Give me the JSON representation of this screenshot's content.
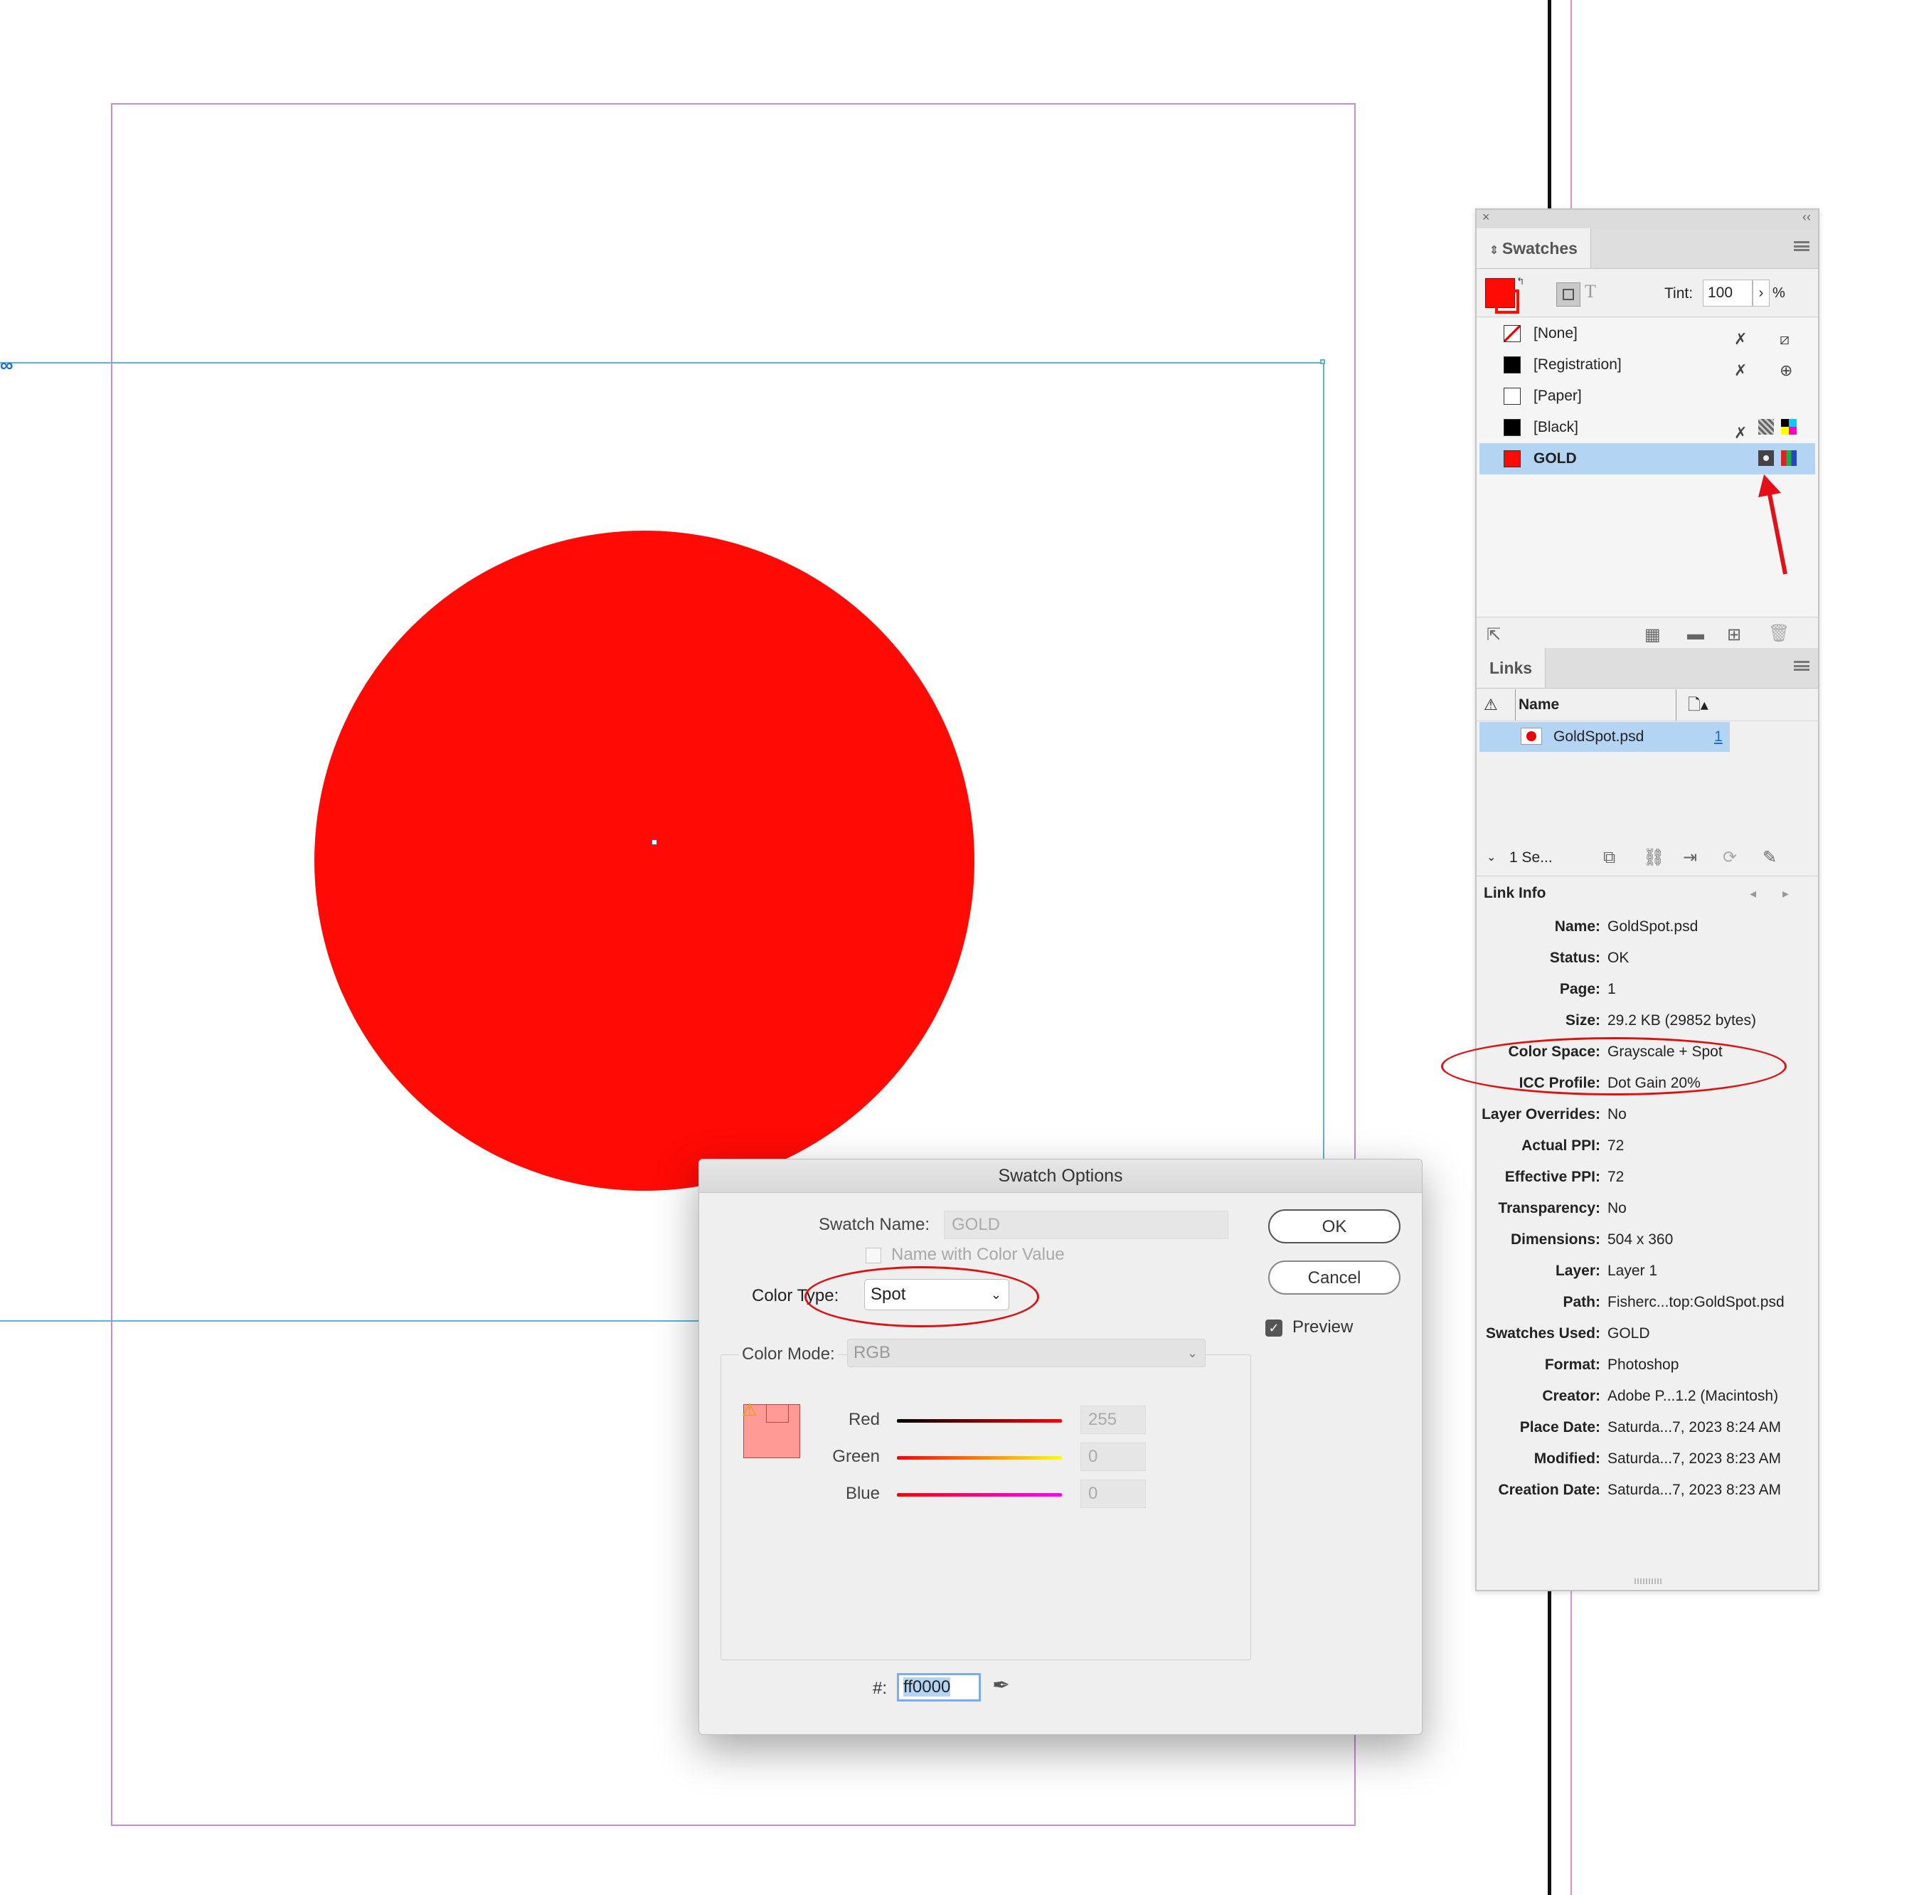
{
  "swatches_panel": {
    "tab_label": "Swatches",
    "tint_label": "Tint:",
    "tint_value": "100",
    "tint_unit": "%",
    "items": [
      {
        "name": "[None]",
        "chip_color": "#ffffff",
        "selected": false
      },
      {
        "name": "[Registration]",
        "chip_color": "#000000",
        "selected": false
      },
      {
        "name": "[Paper]",
        "chip_color": "#ffffff",
        "selected": false
      },
      {
        "name": "[Black]",
        "chip_color": "#000000",
        "selected": false
      },
      {
        "name": "GOLD",
        "chip_color": "#ff0a05",
        "selected": true
      }
    ]
  },
  "links_panel": {
    "tab_label": "Links",
    "column_name": "Name",
    "link_name": "GoldSpot.psd",
    "link_page": "1",
    "selection_summary": "1 Se..."
  },
  "link_info": {
    "title": "Link Info",
    "rows": [
      {
        "label": "Name:",
        "value": "GoldSpot.psd"
      },
      {
        "label": "Status:",
        "value": "OK"
      },
      {
        "label": "Page:",
        "value": "1"
      },
      {
        "label": "Size:",
        "value": "29.2 KB (29852 bytes)"
      },
      {
        "label": "Color Space:",
        "value": "Grayscale + Spot"
      },
      {
        "label": "ICC Profile:",
        "value": "Dot Gain 20%"
      },
      {
        "label": "Layer Overrides:",
        "value": "No"
      },
      {
        "label": "Actual PPI:",
        "value": "72"
      },
      {
        "label": "Effective PPI:",
        "value": "72"
      },
      {
        "label": "Transparency:",
        "value": "No"
      },
      {
        "label": "Dimensions:",
        "value": "504 x 360"
      },
      {
        "label": "Layer:",
        "value": "Layer 1"
      },
      {
        "label": "Path:",
        "value": "Fisherc...top:GoldSpot.psd"
      },
      {
        "label": "Swatches Used:",
        "value": "GOLD"
      },
      {
        "label": "Format:",
        "value": "Photoshop"
      },
      {
        "label": "Creator:",
        "value": "Adobe P...1.2 (Macintosh)"
      },
      {
        "label": "Place Date:",
        "value": "Saturda...7, 2023 8:24 AM"
      },
      {
        "label": "Modified:",
        "value": "Saturda...7, 2023 8:23 AM"
      },
      {
        "label": "Creation Date:",
        "value": "Saturda...7, 2023 8:23 AM"
      }
    ]
  },
  "dialog": {
    "title": "Swatch Options",
    "swatch_name_label": "Swatch Name:",
    "swatch_name_value": "GOLD",
    "name_with_color_value_label": "Name with Color Value",
    "color_type_label": "Color Type:",
    "color_type_value": "Spot",
    "color_mode_label": "Color Mode:",
    "color_mode_value": "RGB",
    "red_label": "Red",
    "red_value": "255",
    "green_label": "Green",
    "green_value": "0",
    "blue_label": "Blue",
    "blue_value": "0",
    "hex_label": "#:",
    "hex_value": "ff0000",
    "ok_label": "OK",
    "cancel_label": "Cancel",
    "preview_label": "Preview",
    "preview_checked": true
  },
  "colors": {
    "spot_red": "#ff0a05",
    "selection_blue": "#b3d4f2",
    "annotation_red": "#dd1111"
  }
}
